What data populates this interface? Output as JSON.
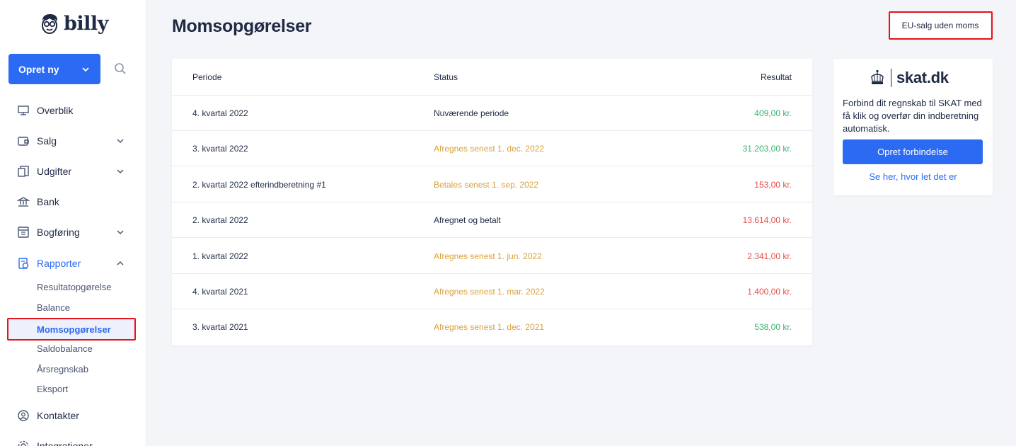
{
  "app": {
    "logo_text": "billy"
  },
  "colors": {
    "accent": "#2b6af2",
    "positive": "#3cb371",
    "negative": "#e0524f",
    "pending": "#d9a13a",
    "text": "#1f2a44",
    "highlight": "#e3141b"
  },
  "sidebar": {
    "create_label": "Opret ny",
    "items": [
      {
        "label": "Overblik",
        "icon": "dashboard-icon"
      },
      {
        "label": "Salg",
        "icon": "wallet-icon"
      },
      {
        "label": "Udgifter",
        "icon": "receipt-icon"
      },
      {
        "label": "Bank",
        "icon": "bank-icon"
      },
      {
        "label": "Bogføring",
        "icon": "ledger-icon"
      },
      {
        "label": "Rapporter",
        "icon": "report-icon"
      },
      {
        "label": "Kontakter",
        "icon": "contacts-icon"
      },
      {
        "label": "Integrationer",
        "icon": "integrations-icon"
      }
    ],
    "sub_items": [
      {
        "label": "Resultatopgørelse"
      },
      {
        "label": "Balance"
      },
      {
        "label": "Momsopgørelser"
      },
      {
        "label": "Saldobalance"
      },
      {
        "label": "Årsregnskab"
      },
      {
        "label": "Eksport"
      }
    ]
  },
  "main": {
    "title": "Momsopgørelser",
    "eu_button": "EU-salg uden moms",
    "table": {
      "headers": {
        "period": "Periode",
        "status": "Status",
        "result": "Resultat"
      },
      "rows": [
        {
          "period": "4. kvartal 2022",
          "status": "Nuværende periode",
          "status_color": "#1f2a44",
          "result": "409,00 kr.",
          "result_color": "#3cb371"
        },
        {
          "period": "3. kvartal 2022",
          "status": "Afregnes senest 1. dec. 2022",
          "status_color": "#d9a13a",
          "result": "31.203,00 kr.",
          "result_color": "#3cb371"
        },
        {
          "period": "2. kvartal 2022 efterindberetning #1",
          "status": "Betales senest 1. sep. 2022",
          "status_color": "#d9a13a",
          "result": "153,00 kr.",
          "result_color": "#e0524f"
        },
        {
          "period": "2. kvartal 2022",
          "status": "Afregnet og betalt",
          "status_color": "#1f2a44",
          "result": "13.614,00 kr.",
          "result_color": "#e0524f"
        },
        {
          "period": "1. kvartal 2022",
          "status": "Afregnes senest 1. jun. 2022",
          "status_color": "#d9a13a",
          "result": "2.341,00 kr.",
          "result_color": "#e0524f"
        },
        {
          "period": "4. kvartal 2021",
          "status": "Afregnes senest 1. mar. 2022",
          "status_color": "#d9a13a",
          "result": "1.400,00 kr.",
          "result_color": "#e0524f"
        },
        {
          "period": "3. kvartal 2021",
          "status": "Afregnes senest 1. dec. 2021",
          "status_color": "#d9a13a",
          "result": "538,00 kr.",
          "result_color": "#3cb371"
        }
      ]
    }
  },
  "skat": {
    "logo_text": "skat.dk",
    "description": "Forbind dit regnskab til SKAT med få klik og overfør din indberetning automatisk.",
    "button": "Opret forbindelse",
    "link": "Se her, hvor let det er"
  }
}
